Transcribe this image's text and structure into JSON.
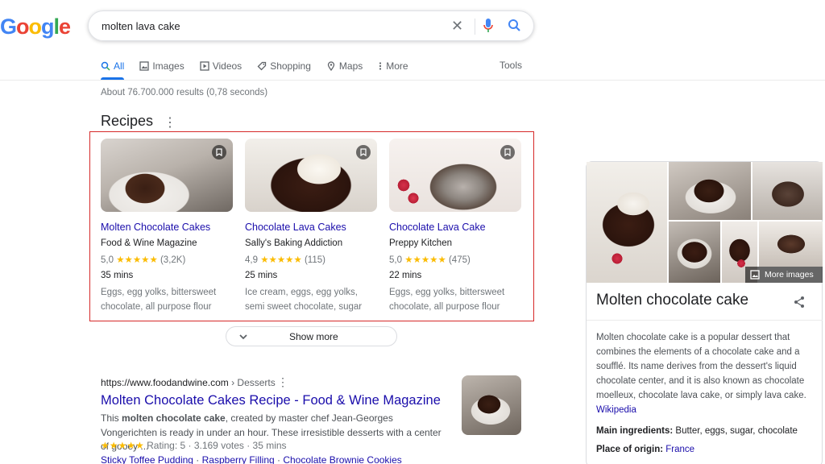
{
  "search": {
    "query": "molten lava cake"
  },
  "tabs": [
    {
      "label": "All"
    },
    {
      "label": "Images"
    },
    {
      "label": "Videos"
    },
    {
      "label": "Shopping"
    },
    {
      "label": "Maps"
    },
    {
      "label": "More"
    }
  ],
  "tools_label": "Tools",
  "stats": "About 76.700.000 results (0,78 seconds)",
  "recipes": {
    "heading": "Recipes",
    "cards": [
      {
        "title": "Molten Chocolate Cakes",
        "source": "Food & Wine Magazine",
        "rating": "5,0",
        "stars": "★★★★★",
        "count": "(3,2K)",
        "time": "35 mins",
        "ingredients": "Eggs, egg yolks, bittersweet chocolate, all purpose flour"
      },
      {
        "title": "Chocolate Lava Cakes",
        "source": "Sally's Baking Addiction",
        "rating": "4,9",
        "stars": "★★★★★",
        "count": "(115)",
        "time": "25 mins",
        "ingredients": "Ice cream, eggs, egg yolks, semi sweet chocolate, sugar"
      },
      {
        "title": "Chocolate Lava Cake",
        "source": "Preppy Kitchen",
        "rating": "5,0",
        "stars": "★★★★★",
        "count": "(475)",
        "time": "22 mins",
        "ingredients": "Eggs, egg yolks, bittersweet chocolate, all purpose flour"
      }
    ],
    "show_more": "Show more"
  },
  "result": {
    "url": "https://www.foodandwine.com",
    "path": " › Desserts",
    "title": "Molten Chocolate Cakes Recipe - Food & Wine Magazine",
    "snippet_pre": "This ",
    "snippet_bold": "molten chocolate cake",
    "snippet_post": ", created by master chef Jean-Georges Vongerichten is ready in under an hour. These irresistible desserts with a center of gooey ...",
    "stars": "★★★★★",
    "meta": " Rating: 5 · 3.169 votes · 35 mins",
    "links": [
      "Sticky Toffee Pudding",
      "Raspberry Filling",
      "Chocolate Brownie Cookies"
    ],
    "link_sep": " · "
  },
  "knowledge_panel": {
    "more_images": "More images",
    "title": "Molten chocolate cake",
    "description": "Molten chocolate cake is a popular dessert that combines the elements of a chocolate cake and a soufflé. Its name derives from the dessert's liquid chocolate center, and it is also known as chocolate moelleux, chocolate lava cake, or simply lava cake.",
    "source_link": "Wikipedia",
    "facts": [
      {
        "label": "Main ingredients:",
        "value": "Butter, eggs, sugar, chocolate"
      },
      {
        "label": "Place of origin:",
        "value": "France"
      }
    ]
  },
  "colors": {
    "link": "#1a0dab",
    "accent": "#1a73e8",
    "star": "#fbbc04",
    "highlight_border": "#d62929"
  }
}
